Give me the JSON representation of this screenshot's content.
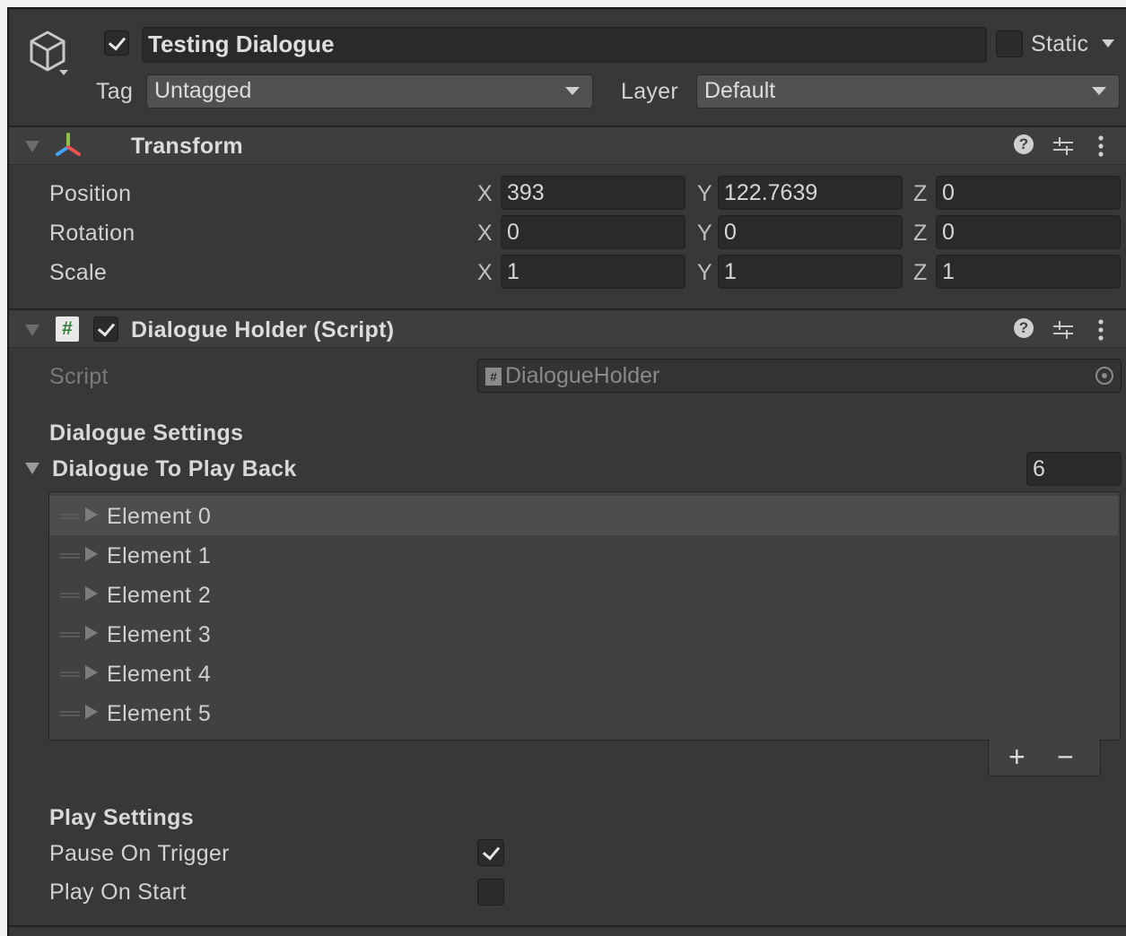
{
  "gameobject": {
    "name": "Testing Dialogue",
    "active": true,
    "static_label": "Static",
    "static": false,
    "tag_label": "Tag",
    "tag_value": "Untagged",
    "layer_label": "Layer",
    "layer_value": "Default"
  },
  "transform": {
    "title": "Transform",
    "rows": [
      {
        "label": "Position",
        "x": "393",
        "y": "122.7639",
        "z": "0"
      },
      {
        "label": "Rotation",
        "x": "0",
        "y": "0",
        "z": "0"
      },
      {
        "label": "Scale",
        "x": "1",
        "y": "1",
        "z": "1"
      }
    ],
    "axis": {
      "x": "X",
      "y": "Y",
      "z": "Z"
    }
  },
  "script_component": {
    "title": "Dialogue Holder (Script)",
    "enabled": true,
    "script_label": "Script",
    "script_value": "DialogueHolder",
    "dialogue_settings_header": "Dialogue Settings",
    "list_label": "Dialogue To Play Back",
    "list_size": "6",
    "elements": [
      "Element 0",
      "Element 1",
      "Element 2",
      "Element 3",
      "Element 4",
      "Element 5"
    ],
    "add_label": "+",
    "remove_label": "−",
    "play_settings_header": "Play Settings",
    "pause_on_trigger_label": "Pause On Trigger",
    "pause_on_trigger": true,
    "play_on_start_label": "Play On Start",
    "play_on_start": false
  },
  "icons": {
    "help": "help-icon",
    "presets": "presets-icon",
    "menu": "kebab-menu-icon"
  },
  "colors": {
    "panel_bg": "#383838",
    "header_bg": "#3e3e3e",
    "field_bg": "#2a2a2a",
    "script_icon": "#4caf50"
  }
}
